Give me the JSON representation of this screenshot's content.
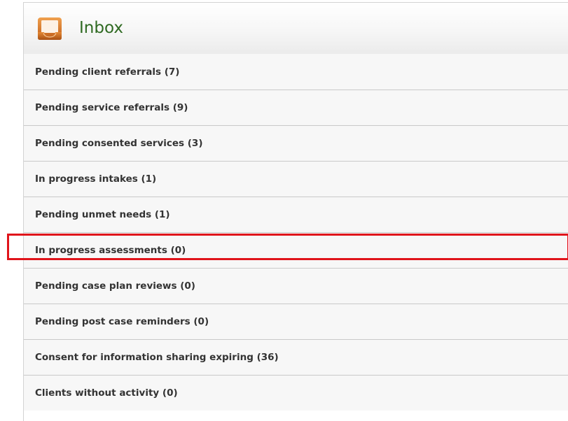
{
  "header": {
    "title": "Inbox",
    "icon": "inbox-tray-icon"
  },
  "colors": {
    "title": "#2f6a22",
    "icon_orange": "#d97a2b",
    "highlight": "#e0141b"
  },
  "items": [
    {
      "label": "Pending client referrals (7)"
    },
    {
      "label": "Pending service referrals (9)"
    },
    {
      "label": "Pending consented services (3)"
    },
    {
      "label": "In progress intakes (1)"
    },
    {
      "label": "Pending unmet needs (1)"
    },
    {
      "label": "In progress assessments (0)",
      "highlighted": true
    },
    {
      "label": "Pending case plan reviews (0)"
    },
    {
      "label": "Pending post case reminders (0)"
    },
    {
      "label": "Consent for information sharing expiring (36)"
    },
    {
      "label": "Clients without activity (0)"
    }
  ]
}
